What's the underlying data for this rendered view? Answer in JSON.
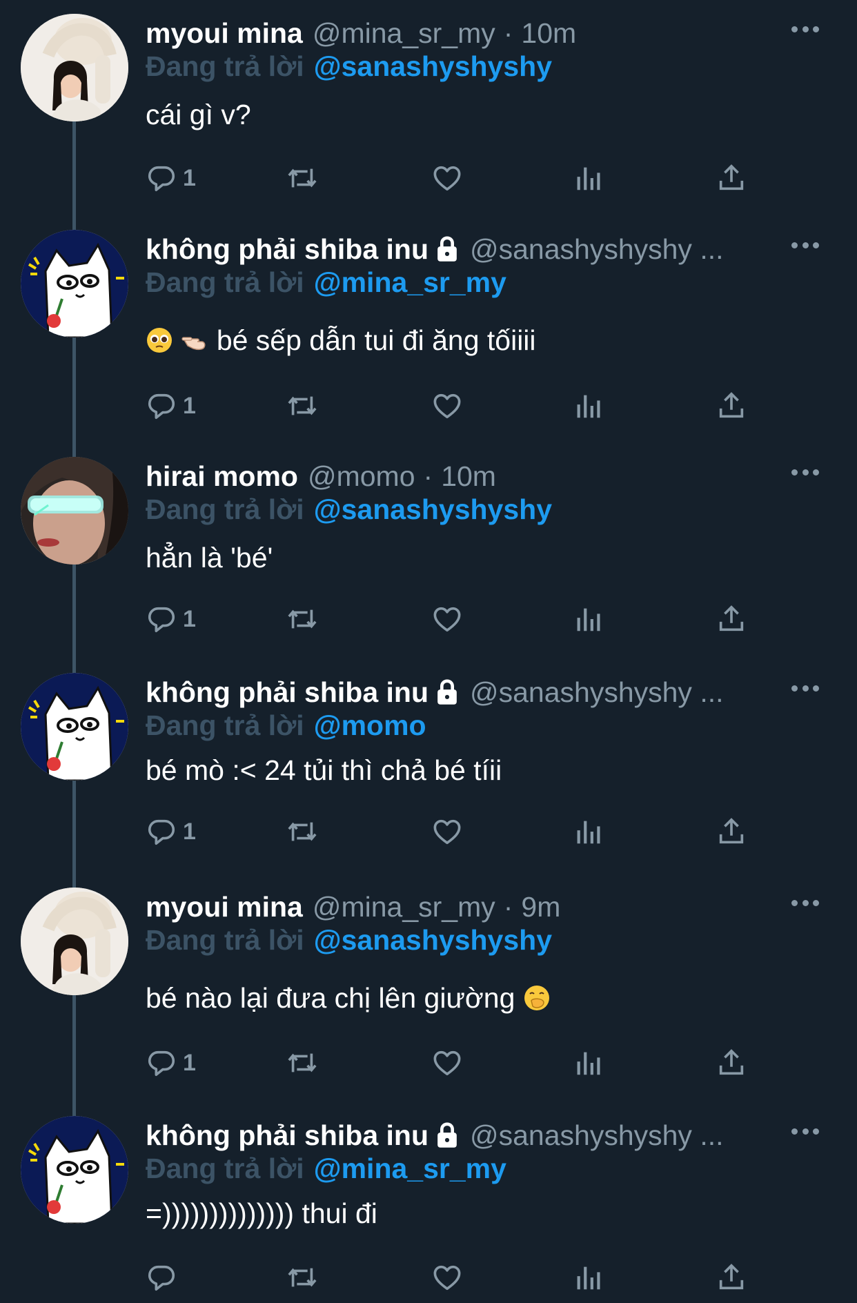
{
  "replying_label": "Đang trả lời",
  "tweets": [
    {
      "name": "myoui mina",
      "handle": "@mina_sr_my",
      "time": "10m",
      "replying_to": "@sanashyshyshy",
      "text": "cái gì v?",
      "reply_count": "1",
      "avatar": "woman-white-sweater"
    },
    {
      "name": "không phải shiba inu",
      "handle": "@sanashyshyshy ...",
      "time": "",
      "replying_to": "@mina_sr_my",
      "text": "bé sếp dẫn tui đi ăng tốiiii",
      "emojis": [
        "pleading-face-emoji",
        "pointing-left-hand-emoji"
      ],
      "reply_count": "1",
      "avatar": "cartoon-cat-rose"
    },
    {
      "name": "hirai momo",
      "handle": "@momo",
      "time": "10m",
      "replying_to": "@sanashyshyshy",
      "text": "hẳn là 'bé'",
      "reply_count": "1",
      "avatar": "woman-neon-visor"
    },
    {
      "name": "không phải shiba inu",
      "handle": "@sanashyshyshy ...",
      "time": "",
      "replying_to": "@momo",
      "text": "bé mò :< 24 tủi thì chả bé tíii",
      "reply_count": "1",
      "avatar": "cartoon-cat-rose"
    },
    {
      "name": "myoui mina",
      "handle": "@mina_sr_my",
      "time": "9m",
      "replying_to": "@sanashyshyshy",
      "text": "bé nào lại đưa chị lên giường",
      "emojis": [
        "hand-over-mouth-emoji"
      ],
      "reply_count": "1",
      "avatar": "woman-white-sweater"
    },
    {
      "name": "không phải shiba inu",
      "handle": "@sanashyshyshy ...",
      "time": "",
      "replying_to": "@mina_sr_my",
      "text": "=)))))))))))))) thui đi",
      "reply_count": "",
      "avatar": "cartoon-cat-rose"
    }
  ],
  "colors": {
    "background": "#15202b",
    "muted": "#8899a6",
    "mention": "#1d9bf0",
    "thread_line": "#3d5466"
  }
}
